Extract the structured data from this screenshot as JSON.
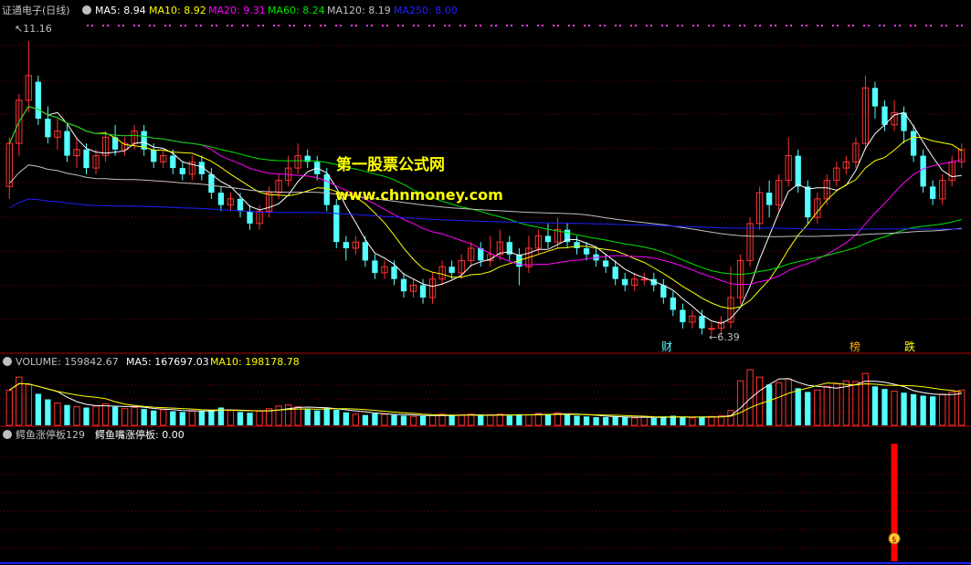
{
  "colors": {
    "up": "#ff3232",
    "down": "#54ffff",
    "ma5": "#ffffff",
    "ma10": "#ffff00",
    "ma20": "#ff00ff",
    "ma60": "#00e600",
    "ma120": "#c0c0c0",
    "ma250": "#2020ff",
    "grid": "#7a0000",
    "label": "#c0c0c0",
    "watermark": "#ffff00",
    "signal": "#ff0000"
  },
  "price_panel": {
    "title": "证通电子(日线)",
    "indicators": [
      {
        "name": "MA5",
        "value": "8.94",
        "color": "#ffffff"
      },
      {
        "name": "MA10",
        "value": "8.92",
        "color": "#ffff00"
      },
      {
        "name": "MA20",
        "value": "9.31",
        "color": "#ff00ff"
      },
      {
        "name": "MA60",
        "value": "8.24",
        "color": "#00e600"
      },
      {
        "name": "MA120",
        "value": "8.19",
        "color": "#c0c0c0"
      },
      {
        "name": "MA250",
        "value": "8.00",
        "color": "#2020ff"
      }
    ],
    "high_label": "11.16",
    "low_label": "6.39",
    "watermark_1": "第一股票公式网",
    "watermark_2": "www.chnmoney.com",
    "tags": [
      {
        "text": "财",
        "color": "#54ffff",
        "x": 137
      },
      {
        "text": "榜",
        "color": "#ffaa00",
        "x": 188
      },
      {
        "text": "跌",
        "color": "#ffff00",
        "x": 201
      }
    ]
  },
  "volume_panel": {
    "title": "VOLUME",
    "value": "159842.67",
    "ma5_label": "MA5",
    "ma5_value": "167697.03",
    "ma10_label": "MA10",
    "ma10_value": "198178.78"
  },
  "indicator_panel": {
    "title": "鳄鱼涨停板129",
    "line_label": "鳄鱼嘴涨停板",
    "line_value": "0.00"
  },
  "chart_data": {
    "type": "candlestick",
    "ylim": [
      6.2,
      11.5
    ],
    "candles": [
      [
        8.8,
        9.5,
        8.6,
        9.6
      ],
      [
        9.5,
        10.2,
        9.3,
        10.3
      ],
      [
        10.2,
        10.6,
        10.0,
        11.16
      ],
      [
        10.5,
        9.9,
        9.8,
        10.6
      ],
      [
        9.9,
        9.6,
        9.5,
        10.1
      ],
      [
        9.6,
        9.7,
        9.4,
        9.9
      ],
      [
        9.7,
        9.3,
        9.2,
        9.8
      ],
      [
        9.3,
        9.4,
        9.1,
        9.6
      ],
      [
        9.4,
        9.1,
        9.0,
        9.5
      ],
      [
        9.1,
        9.3,
        9.0,
        9.4
      ],
      [
        9.3,
        9.6,
        9.2,
        9.7
      ],
      [
        9.6,
        9.4,
        9.3,
        9.8
      ],
      [
        9.4,
        9.5,
        9.3,
        9.6
      ],
      [
        9.5,
        9.7,
        9.4,
        9.8
      ],
      [
        9.7,
        9.4,
        9.3,
        9.8
      ],
      [
        9.4,
        9.2,
        9.1,
        9.5
      ],
      [
        9.2,
        9.3,
        9.1,
        9.4
      ],
      [
        9.3,
        9.1,
        9.0,
        9.4
      ],
      [
        9.1,
        9.0,
        8.9,
        9.2
      ],
      [
        9.0,
        9.2,
        8.9,
        9.3
      ],
      [
        9.2,
        9.0,
        8.9,
        9.3
      ],
      [
        9.0,
        8.7,
        8.6,
        9.1
      ],
      [
        8.7,
        8.5,
        8.4,
        8.8
      ],
      [
        8.5,
        8.6,
        8.4,
        8.7
      ],
      [
        8.6,
        8.4,
        8.3,
        8.7
      ],
      [
        8.4,
        8.2,
        8.1,
        8.5
      ],
      [
        8.2,
        8.4,
        8.1,
        8.5
      ],
      [
        8.4,
        8.7,
        8.3,
        8.8
      ],
      [
        8.7,
        8.9,
        8.6,
        9.0
      ],
      [
        8.9,
        9.1,
        8.8,
        9.3
      ],
      [
        9.1,
        9.3,
        9.0,
        9.5
      ],
      [
        9.3,
        9.2,
        9.1,
        9.4
      ],
      [
        9.2,
        9.0,
        8.9,
        9.3
      ],
      [
        9.0,
        8.5,
        8.4,
        9.1
      ],
      [
        8.5,
        7.9,
        7.8,
        8.6
      ],
      [
        7.9,
        7.8,
        7.6,
        8.0
      ],
      [
        7.8,
        7.9,
        7.7,
        8.0
      ],
      [
        7.9,
        7.6,
        7.5,
        8.0
      ],
      [
        7.6,
        7.4,
        7.3,
        7.7
      ],
      [
        7.4,
        7.5,
        7.3,
        7.6
      ],
      [
        7.5,
        7.3,
        7.2,
        7.6
      ],
      [
        7.3,
        7.1,
        7.0,
        7.4
      ],
      [
        7.1,
        7.2,
        7.0,
        7.3
      ],
      [
        7.2,
        7.0,
        6.9,
        7.3
      ],
      [
        7.0,
        7.3,
        6.9,
        7.4
      ],
      [
        7.3,
        7.5,
        7.2,
        7.6
      ],
      [
        7.5,
        7.4,
        7.3,
        7.6
      ],
      [
        7.4,
        7.6,
        7.3,
        7.7
      ],
      [
        7.6,
        7.8,
        7.5,
        7.9
      ],
      [
        7.8,
        7.6,
        7.5,
        7.9
      ],
      [
        7.6,
        7.7,
        7.5,
        8.0
      ],
      [
        7.7,
        7.9,
        7.6,
        8.1
      ],
      [
        7.9,
        7.7,
        7.6,
        8.0
      ],
      [
        7.7,
        7.5,
        7.2,
        7.8
      ],
      [
        7.5,
        7.8,
        7.4,
        8.0
      ],
      [
        7.8,
        8.0,
        7.7,
        8.1
      ],
      [
        8.0,
        7.9,
        7.8,
        8.2
      ],
      [
        7.9,
        8.1,
        7.8,
        8.3
      ],
      [
        8.1,
        7.9,
        7.8,
        8.2
      ],
      [
        7.9,
        7.8,
        7.7,
        8.0
      ],
      [
        7.8,
        7.7,
        7.6,
        7.9
      ],
      [
        7.7,
        7.6,
        7.5,
        7.8
      ],
      [
        7.6,
        7.5,
        7.4,
        7.7
      ],
      [
        7.5,
        7.3,
        7.2,
        7.6
      ],
      [
        7.3,
        7.2,
        7.1,
        7.4
      ],
      [
        7.2,
        7.3,
        7.1,
        7.4
      ],
      [
        7.3,
        7.3,
        7.2,
        7.4
      ],
      [
        7.3,
        7.2,
        7.1,
        7.4
      ],
      [
        7.2,
        7.0,
        6.9,
        7.3
      ],
      [
        7.0,
        6.8,
        6.7,
        7.1
      ],
      [
        6.8,
        6.6,
        6.5,
        6.9
      ],
      [
        6.6,
        6.7,
        6.5,
        6.8
      ],
      [
        6.7,
        6.5,
        6.4,
        6.8
      ],
      [
        6.5,
        6.5,
        6.4,
        6.6
      ],
      [
        6.5,
        6.6,
        6.39,
        6.7
      ],
      [
        6.6,
        7.0,
        6.5,
        7.5
      ],
      [
        7.0,
        7.6,
        6.9,
        7.7
      ],
      [
        7.6,
        8.2,
        7.5,
        8.3
      ],
      [
        8.2,
        8.7,
        8.1,
        8.8
      ],
      [
        8.7,
        8.5,
        8.3,
        8.9
      ],
      [
        8.5,
        8.9,
        8.4,
        9.0
      ],
      [
        8.9,
        9.3,
        8.8,
        9.6
      ],
      [
        9.3,
        8.8,
        8.7,
        9.4
      ],
      [
        8.8,
        8.3,
        8.2,
        8.9
      ],
      [
        8.3,
        8.6,
        8.2,
        8.7
      ],
      [
        8.6,
        8.9,
        8.5,
        9.0
      ],
      [
        8.9,
        9.1,
        8.8,
        9.2
      ],
      [
        9.1,
        9.2,
        9.0,
        9.3
      ],
      [
        9.2,
        9.5,
        9.1,
        9.6
      ],
      [
        9.5,
        10.4,
        9.4,
        10.6
      ],
      [
        10.4,
        10.1,
        9.9,
        10.5
      ],
      [
        10.1,
        9.8,
        9.7,
        10.2
      ],
      [
        9.8,
        10.0,
        9.7,
        10.2
      ],
      [
        10.0,
        9.7,
        9.5,
        10.1
      ],
      [
        9.7,
        9.3,
        9.2,
        9.8
      ],
      [
        9.3,
        8.8,
        8.7,
        9.4
      ],
      [
        8.8,
        8.6,
        8.5,
        8.9
      ],
      [
        8.6,
        8.9,
        8.5,
        9.0
      ],
      [
        8.9,
        9.2,
        8.8,
        9.3
      ],
      [
        9.2,
        9.4,
        9.1,
        9.5
      ]
    ],
    "volume": [
      95,
      130,
      110,
      85,
      70,
      60,
      55,
      50,
      48,
      52,
      58,
      50,
      45,
      48,
      44,
      40,
      42,
      38,
      36,
      40,
      38,
      42,
      48,
      40,
      36,
      34,
      38,
      45,
      52,
      55,
      50,
      44,
      40,
      48,
      42,
      35,
      30,
      28,
      32,
      30,
      28,
      26,
      24,
      25,
      28,
      30,
      26,
      28,
      30,
      26,
      28,
      30,
      26,
      30,
      28,
      32,
      30,
      34,
      30,
      26,
      24,
      22,
      22,
      24,
      22,
      20,
      22,
      20,
      24,
      26,
      22,
      20,
      22,
      24,
      26,
      40,
      120,
      150,
      130,
      110,
      115,
      125,
      100,
      90,
      95,
      105,
      112,
      120,
      118,
      140,
      105,
      98,
      92,
      88,
      84,
      80,
      78,
      84,
      90,
      95
    ],
    "signal_at": 92
  }
}
